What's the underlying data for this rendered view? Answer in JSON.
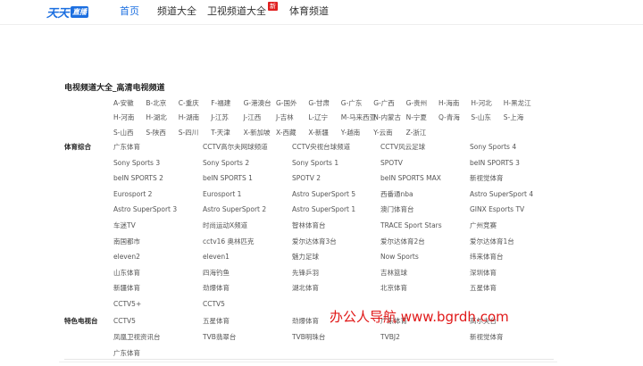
{
  "header": {
    "logo_text": "天天",
    "logo_badge": "直播",
    "nav": [
      {
        "label": "首页"
      },
      {
        "label": "频道大全"
      },
      {
        "label": "卫视频道大全",
        "badge": "新"
      },
      {
        "label": "体育频道"
      }
    ]
  },
  "section_title": "电视频道大全_高清电视频道",
  "regions": [
    "A-安徽",
    "B-北京",
    "C-重庆",
    "F-福建",
    "G-港澳台",
    "G-国外",
    "G-甘肃",
    "G-广东",
    "G-广西",
    "G-贵州",
    "H-海南",
    "H-河北",
    "H-黑龙江",
    "H-河南",
    "H-湖北",
    "H-湖南",
    "J-江苏",
    "J-江西",
    "J-吉林",
    "L-辽宁",
    "M-马来西亚",
    "N-内蒙古",
    "N-宁夏",
    "Q-青海",
    "S-山东",
    "S-上海",
    "S-山西",
    "S-陕西",
    "S-四川",
    "T-天津",
    "X-新加坡",
    "X-西藏",
    "X-新疆",
    "Y-越南",
    "Y-云南",
    "Z-浙江"
  ],
  "categories": {
    "sports_label": "体育综合",
    "special_label": "特色电视台"
  },
  "sports_channels": [
    "广东体育",
    "CCTV高尔夫网球频道",
    "CCTV央视台球频道",
    "CCTV风云足球",
    "Sony Sports 4",
    "Sony Sports 3",
    "Sony Sports 2",
    "Sony Sports 1",
    "SPOTV",
    "beIN SPORTS 3",
    "beIN SPORTS 2",
    "beIN SPORTS 1",
    "SPOTV 2",
    "beIN SPORTS MAX",
    "新视觉体育",
    "Eurosport 2",
    "Eurosport 1",
    "Astro SuperSport 5",
    "西番通nba",
    "Astro SuperSport 4",
    "Astro SuperSport 3",
    "Astro SuperSport 2",
    "Astro SuperSport 1",
    "澳门体育台",
    "GINX Esports TV",
    "车迷TV",
    "时尚运动X频道",
    "智林体育台",
    "TRACE Sport Stars",
    "广州竞赛",
    "南国都市",
    "cctv16 奥林匹克",
    "爱尔达体育3台",
    "爱尔达体育2台",
    "爱尔达体育1台",
    "eleven2",
    "eleven1",
    "魅力足球",
    "Now Sports",
    "纬来体育台",
    "山东体育",
    "四海钓鱼",
    "先锋乒羽",
    "吉林篮球",
    "深圳体育",
    "新疆体育",
    "劲爆体育",
    "湖北体育",
    "北京体育",
    "五星体育",
    "CCTV5+",
    "CCTV5"
  ],
  "special_channels": [
    "CCTV5",
    "五星体育",
    "劲爆体育",
    "广东体育",
    "高尔夫台",
    "凤凰卫视资讯台",
    "TVB翡翠台",
    "TVB明珠台",
    "TVBJ2",
    "新视觉体育",
    "广东体育"
  ],
  "watermark": "办公人导航 www.bgrdh.com",
  "colors": {
    "accent": "#1c6fe0",
    "badge_red": "#e02020",
    "watermark": "#e01818"
  }
}
